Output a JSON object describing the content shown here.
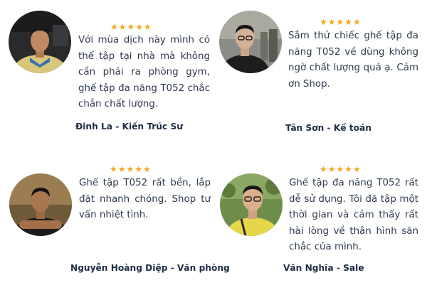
{
  "star_color": "#f2a91f",
  "text_color": "#2d3a4f",
  "testimonials": [
    {
      "rating": 5,
      "stars": "★★★★★",
      "quote": "Với mùa dịch này mình có thể tập tại nhà mà không cần phải ra phòng gym, ghế tập đa năng T052 chắc chắn chất lượng.",
      "author": "Đinh La - Kiến Trúc Sư",
      "avatar_icon": "man-in-yellow-shirt-avatar"
    },
    {
      "rating": 5,
      "stars": "★★★★★",
      "quote": "Sắm thử chiếc ghế tập đa năng T052 về dùng không ngờ chất lượng quá ạ. Cảm ơn Shop.",
      "author": "Tân Sơn - Kế toán",
      "avatar_icon": "man-with-glasses-outdoor-avatar"
    },
    {
      "rating": 5,
      "stars": "★★★★★",
      "quote": "Ghế tập T052  rất bền, lắp đặt nhanh chóng. Shop tư vấn nhiệt tình.",
      "author": "Nguyễn Hoàng Diệp - Văn phòng",
      "avatar_icon": "man-arms-crossed-avatar"
    },
    {
      "rating": 5,
      "stars": "★★★★★",
      "quote": "Ghế tập đa năng T052 rất dễ sử dụng. Tôi đã tập một thời gian và cảm thấy rất hài lòng về thân hình săn chắc của mình.",
      "author": "Văn Nghĩa - Sale",
      "avatar_icon": "man-with-glasses-yellow-shirt-avatar"
    }
  ]
}
